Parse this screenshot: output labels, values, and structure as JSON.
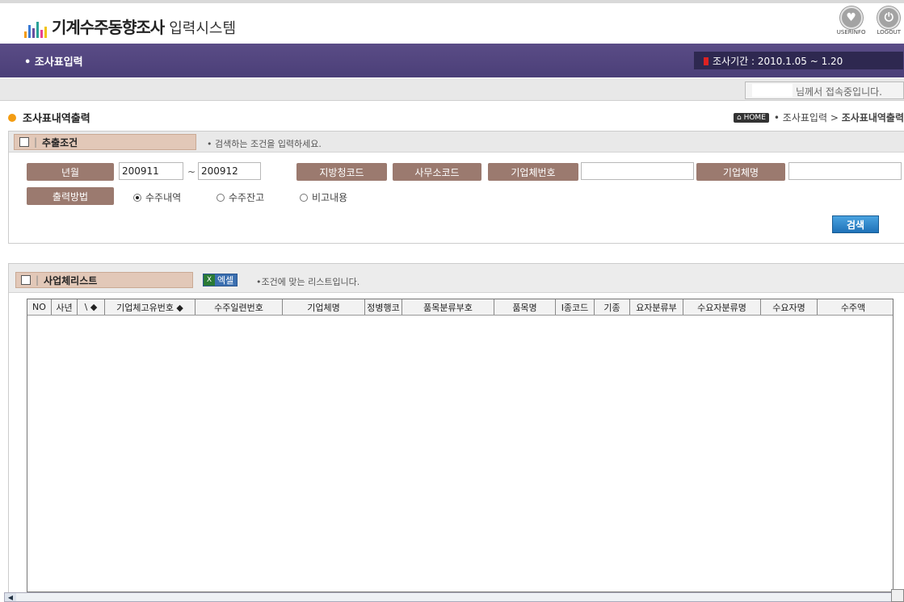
{
  "header": {
    "logo_main": "기계수주동향조사",
    "logo_sub": "입력시스템",
    "userinfo_label": "USERINFO",
    "logout_label": "LOGOUT"
  },
  "nav": {
    "title": "• 조사표입력",
    "period": "조사기간 : 2010.1.05 ~ 1.20"
  },
  "user": {
    "status": "님께서 접속중입니다."
  },
  "page": {
    "title": "조사표내역출력",
    "breadcrumb_home": "HOME",
    "breadcrumb_sep1": "•",
    "breadcrumb_parent": "조사표입력",
    "breadcrumb_sep2": ">",
    "breadcrumb_current": "조사표내역출력"
  },
  "search": {
    "header_title": "추출조건",
    "hint": "• 검색하는 조건을 입력하세요.",
    "labels": {
      "year_month": "년월",
      "region_code": "지방청코드",
      "office_code": "사무소코드",
      "company_number": "기업체번호",
      "company_name": "기업체명",
      "output_method": "출력방법"
    },
    "from_value": "200911",
    "to_value": "200912",
    "tilde": "~",
    "company_number_value": "",
    "company_name_value": "",
    "radio_options": [
      "수주내역",
      "수주잔고",
      "비고내용"
    ],
    "radio_selected": 0,
    "search_button": "검색"
  },
  "list": {
    "header_title": "사업체리스트",
    "excel_button": "엑셀",
    "hint": "•조건에 맞는 리스트입니다.",
    "columns": [
      "NO",
      "사년",
      "\\ ◆",
      "기업체고유번호 ◆",
      "수주일련번호",
      "기업체명",
      "정병행코",
      "품목분류부호",
      "품목명",
      "I종코드",
      "기종",
      "요자분류부",
      "수요자분류명",
      "수요자명",
      "수주액"
    ]
  },
  "colors": {
    "purple": "#4b3f78",
    "label_brown": "#9b7a6f",
    "accent_orange": "#f39c12",
    "search_blue": "#1f72b8"
  }
}
